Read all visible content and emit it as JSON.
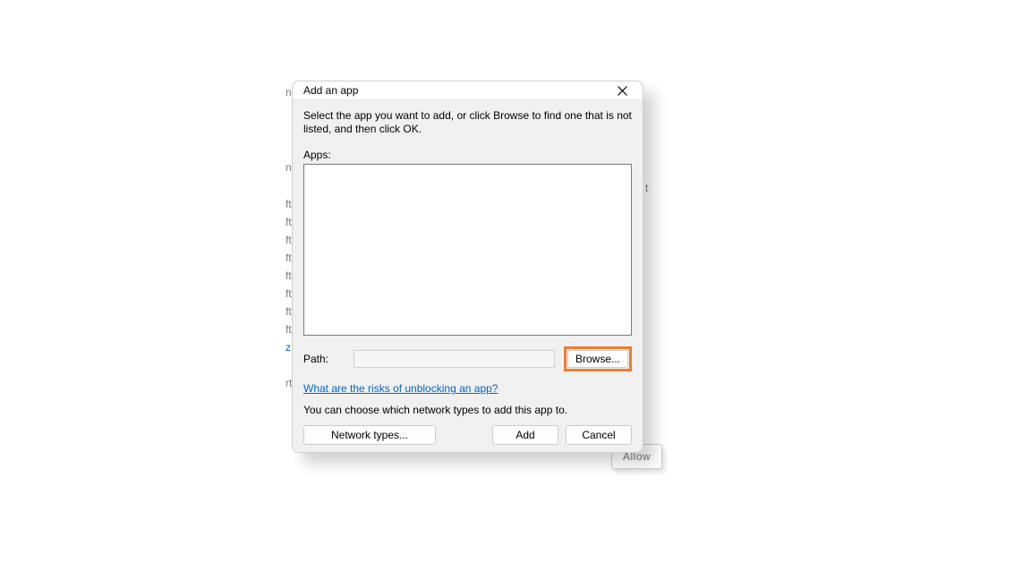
{
  "bg": {
    "left_fragments": [
      "n",
      "n",
      "ft",
      "ft",
      "ft",
      "ft",
      "ft",
      "ft",
      "ft",
      "ft",
      "z",
      "rt",
      "t"
    ],
    "right_allow_fragment": "Allow",
    "right_t": "t"
  },
  "dialog": {
    "title": "Add an app",
    "instructions": "Select the app you want to add, or click Browse to find one that is not listed, and then click OK.",
    "apps_label": "Apps:",
    "path_label": "Path:",
    "path_value": "",
    "browse_label": "Browse...",
    "risks_link": "What are the risks of unblocking an app?",
    "network_line": "You can choose which network types to add this app to.",
    "network_types_button": "Network types...",
    "add_button": "Add",
    "cancel_button": "Cancel"
  }
}
